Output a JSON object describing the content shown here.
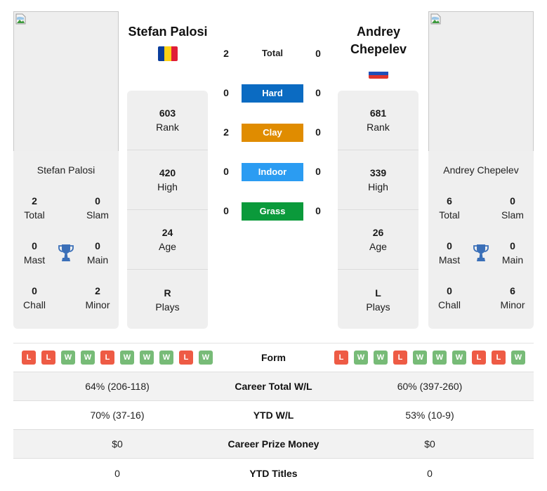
{
  "left_player": {
    "name": "Stefan Palosi",
    "flag_colors": [
      "#0a3d9c",
      "#fcd116",
      "#e01e37"
    ],
    "photo_icon": "broken-image-icon",
    "stats": [
      {
        "value": "603",
        "label": "Rank"
      },
      {
        "value": "420",
        "label": "High"
      },
      {
        "value": "24",
        "label": "Age"
      },
      {
        "value": "R",
        "label": "Plays"
      }
    ],
    "titles": {
      "total": {
        "value": "2",
        "label": "Total"
      },
      "slam": {
        "value": "0",
        "label": "Slam"
      },
      "mast": {
        "value": "0",
        "label": "Mast"
      },
      "main": {
        "value": "0",
        "label": "Main"
      },
      "chall": {
        "value": "0",
        "label": "Chall"
      },
      "minor": {
        "value": "2",
        "label": "Minor"
      }
    },
    "form": [
      "L",
      "L",
      "W",
      "W",
      "L",
      "W",
      "W",
      "W",
      "L",
      "W"
    ]
  },
  "right_player": {
    "name": "Andrey Chepelev",
    "flag_colors": [
      "#ffffff",
      "#1f4fb8",
      "#e0352b"
    ],
    "photo_icon": "broken-image-icon",
    "stats": [
      {
        "value": "681",
        "label": "Rank"
      },
      {
        "value": "339",
        "label": "High"
      },
      {
        "value": "26",
        "label": "Age"
      },
      {
        "value": "L",
        "label": "Plays"
      }
    ],
    "titles": {
      "total": {
        "value": "6",
        "label": "Total"
      },
      "slam": {
        "value": "0",
        "label": "Slam"
      },
      "mast": {
        "value": "0",
        "label": "Mast"
      },
      "main": {
        "value": "0",
        "label": "Main"
      },
      "chall": {
        "value": "0",
        "label": "Chall"
      },
      "minor": {
        "value": "6",
        "label": "Minor"
      }
    },
    "form": [
      "L",
      "W",
      "W",
      "L",
      "W",
      "W",
      "W",
      "L",
      "L",
      "W"
    ]
  },
  "h2h": [
    {
      "label": "Total",
      "left": "2",
      "right": "0",
      "color": null
    },
    {
      "label": "Hard",
      "left": "0",
      "right": "0",
      "color": "#0b6bc2"
    },
    {
      "label": "Clay",
      "left": "2",
      "right": "0",
      "color": "#e08c00"
    },
    {
      "label": "Indoor",
      "left": "0",
      "right": "0",
      "color": "#2b9cf2"
    },
    {
      "label": "Grass",
      "left": "0",
      "right": "0",
      "color": "#0b9a3b"
    }
  ],
  "comparison": {
    "form_label": "Form",
    "rows": [
      {
        "label": "Career Total W/L",
        "left": "64% (206-118)",
        "right": "60% (397-260)"
      },
      {
        "label": "YTD W/L",
        "left": "70% (37-16)",
        "right": "53% (10-9)"
      },
      {
        "label": "Career Prize Money",
        "left": "$0",
        "right": "$0"
      },
      {
        "label": "YTD Titles",
        "left": "0",
        "right": "0"
      }
    ]
  },
  "colors": {
    "win": "#77bb77",
    "loss": "#ee5b45",
    "trophy": "#3a6fb8"
  }
}
